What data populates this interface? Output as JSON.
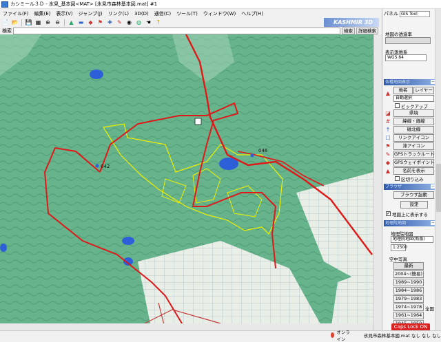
{
  "window": {
    "title": "カシミール３Ｄ - 氷見_基本図<MAT> [氷見市森林基本図.mat] #1"
  },
  "menu": [
    "ファイル(F)",
    "編集(E)",
    "表示(V)",
    "ジャンプ(J)",
    "リンク(L)",
    "3D(D)",
    "通信(C)",
    "ツール(T)",
    "ウィンドウ(W)",
    "ヘルプ(H)"
  ],
  "brand": "KASHMIR 3D",
  "search": {
    "label": "検索",
    "value": "",
    "search_button": "検索",
    "detail_button": "詳細検索"
  },
  "map": {
    "labels": [
      "046",
      "042"
    ]
  },
  "panel": {
    "title": "パネル",
    "tool_select": "GIS Tool",
    "transparency_label": "地図の透過率",
    "datum_label": "表示測地系",
    "datum_select": "WGS 84",
    "sections": {
      "map_display": "各種地図表示",
      "gps": "ブラウザ",
      "base_map": "地理院地図"
    },
    "map_name_button": "地名",
    "layer_button": "レイヤー",
    "auto_select": "自動選択",
    "pop_checkbox": "ビックアップ",
    "items": [
      "県境",
      "緯線・経線",
      "磁北線",
      "リンクアイコン",
      "滞アイコン",
      "GPSトラックルート",
      "GPSウェイポイント",
      "名前を表示"
    ],
    "crop_checkbox": "区切り込み",
    "browser_button": "ブラウザ起動",
    "settings_button": "設定",
    "show_on_map": "地図上に表示する",
    "chiriin_label": "地理院地図",
    "chiriin_select": "地理院地図(新版)",
    "scale_input": "1:2500",
    "aerial_label": "空中写真",
    "photo_buttons": [
      "最新",
      "2004~(簡易)",
      "1989~1990",
      "1984~1986",
      "1979~1983",
      "1974~1978",
      "1961~1964",
      "1945~1950"
    ],
    "all_country": "全国",
    "caps_lock": "Caps Lock ON"
  },
  "status": {
    "online": "オンライン",
    "map_file": "氷見市森林基本図.mat なし なし なし"
  },
  "colors": {
    "route": "#e01818",
    "boundary": "#f0f000",
    "terrain": "#5fae87",
    "water": "#2d5fd8"
  }
}
